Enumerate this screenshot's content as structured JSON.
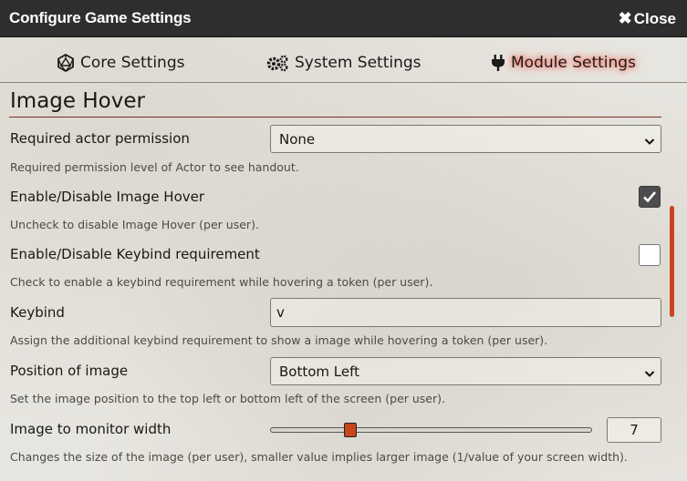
{
  "window": {
    "title": "Configure Game Settings",
    "close_label": "Close",
    "close_icon": "times-icon"
  },
  "tabs": [
    {
      "label": "Core Settings",
      "icon": "d20-icon",
      "active": false
    },
    {
      "label": "System Settings",
      "icon": "gears-icon",
      "active": false
    },
    {
      "label": "Module Settings",
      "icon": "plug-icon",
      "active": true
    }
  ],
  "section": {
    "title": "Image Hover"
  },
  "settings": {
    "permission": {
      "label": "Required actor permission",
      "value": "None",
      "hint": "Required permission level of Actor to see handout."
    },
    "enable_hover": {
      "label": "Enable/Disable Image Hover",
      "checked": true,
      "hint": "Uncheck to disable Image Hover (per user)."
    },
    "keybind_req": {
      "label": "Enable/Disable Keybind requirement",
      "checked": false,
      "hint": "Check to enable a keybind requirement while hovering a token (per user)."
    },
    "keybind": {
      "label": "Keybind",
      "value": "v",
      "hint": "Assign the additional keybind requirement to show a image while hovering a token (per user)."
    },
    "position": {
      "label": "Position of image",
      "value": "Bottom Left",
      "hint": "Set the image position to the top left or bottom left of the screen (per user)."
    },
    "monitor_width": {
      "label": "Image to monitor width",
      "value": "7",
      "fraction": 0.24,
      "hint": "Changes the size of the image (per user), smaller value implies larger image (1/value of your screen width)."
    }
  },
  "colors": {
    "accent": "#c9451d",
    "titlebar": "#2e2e2e",
    "parchment": "#e7e5df"
  }
}
